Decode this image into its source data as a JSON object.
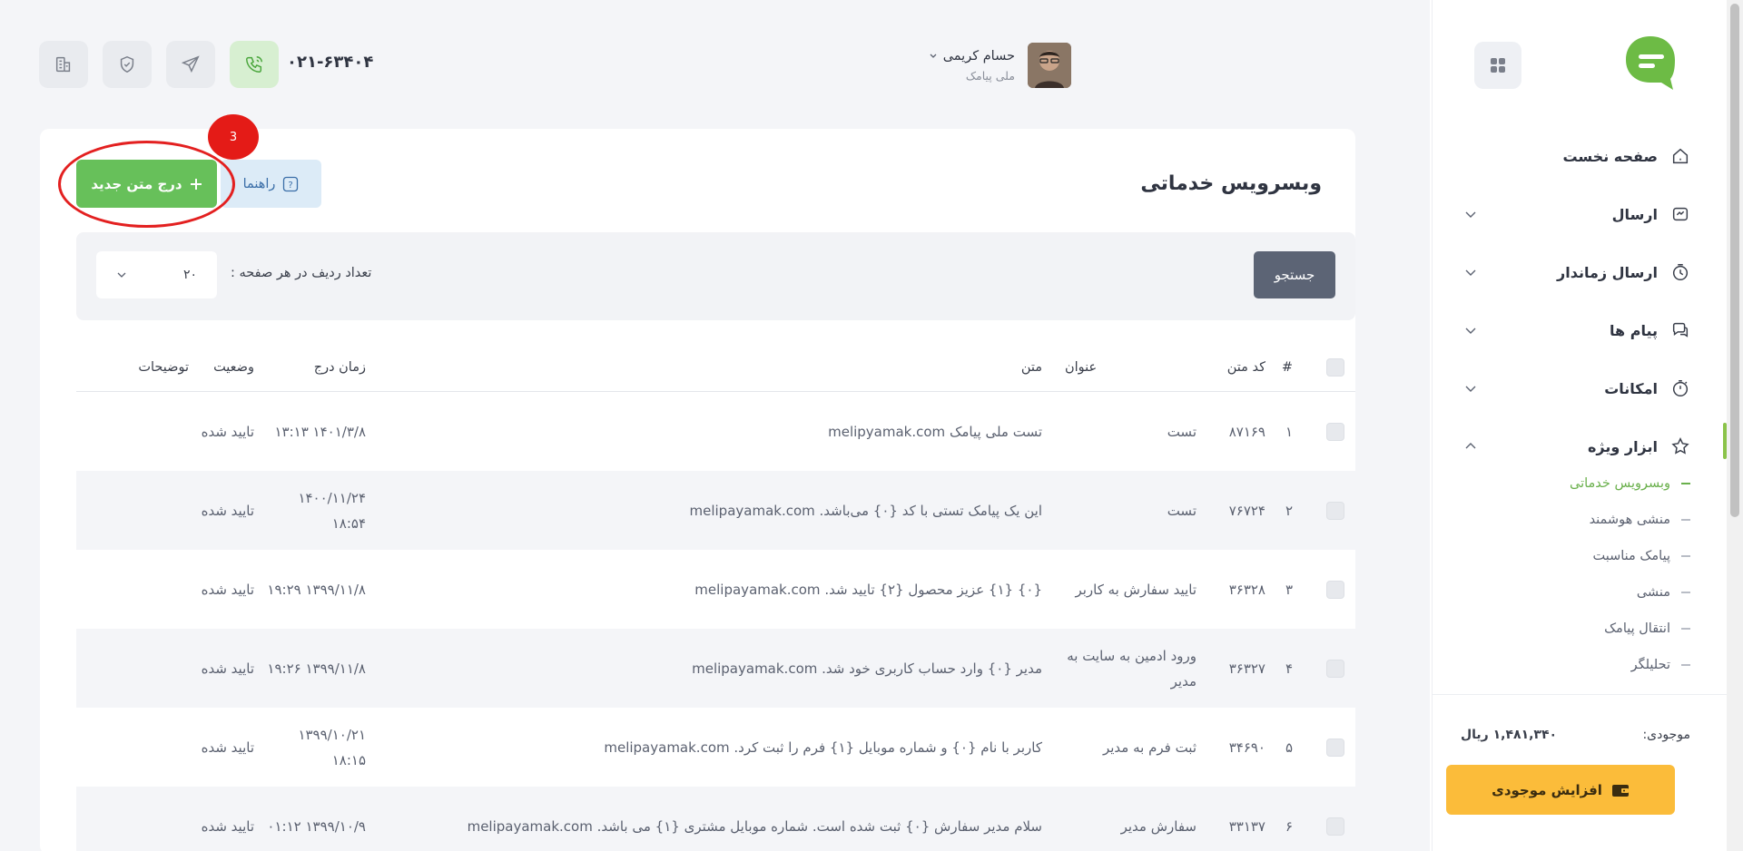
{
  "header": {
    "phone": "۰۲۱-۶۳۴۰۴",
    "user_name": "حسام کریمی",
    "user_org": "ملی پیامک"
  },
  "page": {
    "title": "وبسرویس خدماتی",
    "help_label": "راهنما",
    "add_label": "درج متن جدید",
    "annotation_number": "3"
  },
  "filter": {
    "search_label": "جستجو",
    "rows_label": "تعداد ردیف در هر صفحه :",
    "rows_value": "۲۰"
  },
  "table": {
    "headers": {
      "num": "#",
      "code": "کد متن",
      "title": "عنوان",
      "text": "متن",
      "time": "زمان درج",
      "status": "وضعیت",
      "desc": "توضیحات"
    },
    "rows": [
      {
        "num": "۱",
        "code": "۸۷۱۶۹",
        "title": "تست",
        "text": "تست ملی پیامک melipyamak.com",
        "time": "۱۴۰۱/۳/۸ ۱۳:۱۳",
        "status": "تایید شده",
        "desc": ""
      },
      {
        "num": "۲",
        "code": "۷۶۷۲۴",
        "title": "تست",
        "text": "این یک پیامک تستی با کد {۰} می‌باشد. melipayamak.com",
        "time": "۱۴۰۰/۱۱/۲۴ ۱۸:۵۴",
        "status": "تایید شده",
        "desc": ""
      },
      {
        "num": "۳",
        "code": "۳۶۳۲۸",
        "title": "تایید سفارش به کاربر",
        "text": "{۰} {۱} عزیز محصول {۲} تایید شد. melipayamak.com",
        "time": "۱۳۹۹/۱۱/۸ ۱۹:۲۹",
        "status": "تایید شده",
        "desc": ""
      },
      {
        "num": "۴",
        "code": "۳۶۳۲۷",
        "title": "ورود ادمین به سایت به مدیر",
        "text": "مدیر {۰} وارد حساب کاربری خود شد. melipayamak.com",
        "time": "۱۳۹۹/۱۱/۸ ۱۹:۲۶",
        "status": "تایید شده",
        "desc": ""
      },
      {
        "num": "۵",
        "code": "۳۴۶۹۰",
        "title": "ثبت فرم به مدیر",
        "text": "کاربر با نام {۰} و شماره موبایل {۱} فرم را ثبت کرد. melipayamak.com",
        "time": "۱۳۹۹/۱۰/۲۱ ۱۸:۱۵",
        "status": "تایید شده",
        "desc": ""
      },
      {
        "num": "۶",
        "code": "۳۳۱۳۷",
        "title": "سفارش مدیر",
        "text": "سلام مدیر سفارش {۰} ثبت شده است. شماره موبایل مشتری {۱} می باشد. melipayamak.com",
        "time": "۱۳۹۹/۱۰/۹ ۰۱:۱۲",
        "status": "تایید شده",
        "desc": ""
      }
    ]
  },
  "sidebar": {
    "items": [
      {
        "label": "صفحه نخست",
        "icon": "home-icon"
      },
      {
        "label": "ارسال",
        "icon": "send-icon"
      },
      {
        "label": "ارسال زماندار",
        "icon": "timer-icon"
      },
      {
        "label": "پیام ها",
        "icon": "chat-icon"
      },
      {
        "label": "امکانات",
        "icon": "stopwatch-icon"
      },
      {
        "label": "ابزار ویژه",
        "icon": "star-icon"
      }
    ],
    "subitems": [
      {
        "label": "وبسرویس خدماتی"
      },
      {
        "label": "منشی هوشمند"
      },
      {
        "label": "پیامک مناسبت"
      },
      {
        "label": "منشی"
      },
      {
        "label": "انتقال پیامک"
      },
      {
        "label": "تحلیلگر"
      }
    ],
    "balance_label": "موجودی:",
    "balance_value": "۱,۴۸۱,۳۴۰ ریال",
    "topup_label": "افزایش موجودی"
  },
  "colors": {
    "accent_green": "#67c05a",
    "brand_green": "#6dbb45",
    "topup_yellow": "#fbbc3a",
    "annotation_red": "#e41b17"
  }
}
